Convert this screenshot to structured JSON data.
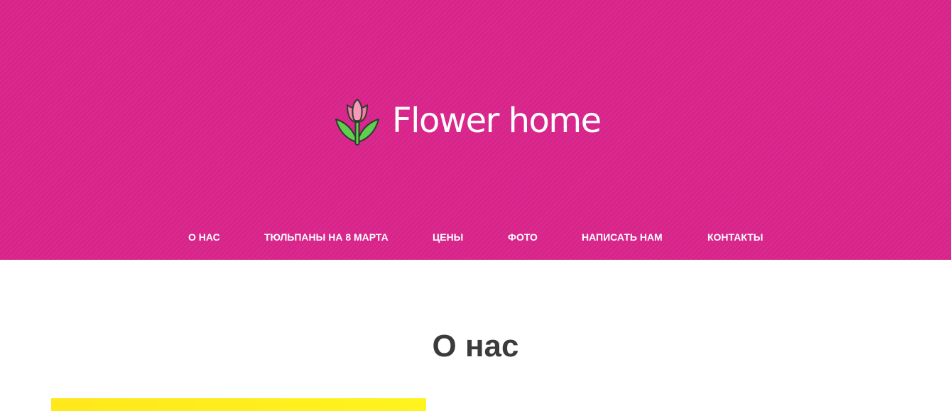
{
  "site": {
    "title": "Flower home",
    "logo_icon": "tulip-icon",
    "brand_color": "#d8248a"
  },
  "nav": {
    "items": [
      {
        "label": "О НАС"
      },
      {
        "label": "ТЮЛЬПАНЫ НА 8 МАРТА"
      },
      {
        "label": "ЦЕНЫ"
      },
      {
        "label": "ФОТО"
      },
      {
        "label": "НАПИСАТЬ НАМ"
      },
      {
        "label": "КОНТАКТЫ"
      }
    ]
  },
  "about": {
    "title": "О нас"
  }
}
